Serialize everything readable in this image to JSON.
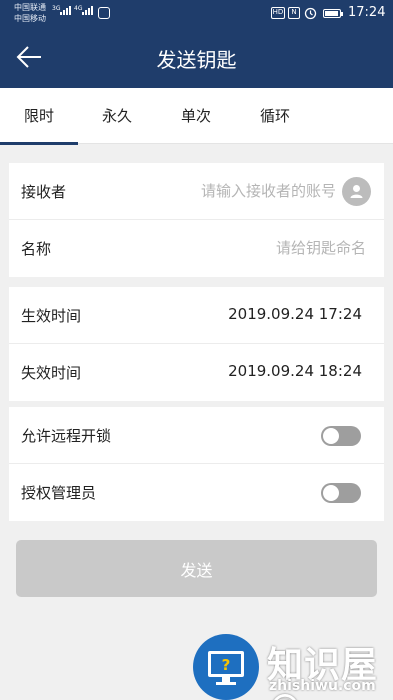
{
  "status_bar": {
    "carrier_1": "中国联通",
    "carrier_2": "中国移动",
    "net_1": "3G",
    "net_2": "4G",
    "hd_label": "HD",
    "nfc_label": "N",
    "time": "17:24"
  },
  "header": {
    "title": "发送钥匙",
    "back_icon": "arrow-left-icon"
  },
  "tabs": [
    {
      "label": "限时",
      "active": true
    },
    {
      "label": "永久",
      "active": false
    },
    {
      "label": "单次",
      "active": false
    },
    {
      "label": "循环",
      "active": false
    }
  ],
  "form": {
    "receiver_label": "接收者",
    "receiver_placeholder": "请输入接收者的账号",
    "receiver_value": "",
    "name_label": "名称",
    "name_placeholder": "请给钥匙命名",
    "name_value": ""
  },
  "time": {
    "start_label": "生效时间",
    "start_value": "2019.09.24 17:24",
    "end_label": "失效时间",
    "end_value": "2019.09.24 18:24"
  },
  "options": {
    "remote_label": "允许远程开锁",
    "remote_on": false,
    "admin_label": "授权管理员",
    "admin_on": false
  },
  "send_label": "发送",
  "watermark": {
    "cn": "知识屋®",
    "en": "zhishiwu.com"
  },
  "colors": {
    "header_bg": "#1f3d6b",
    "send_disabled": "#c9c9c9",
    "toggle_off": "#9e9e9e"
  }
}
